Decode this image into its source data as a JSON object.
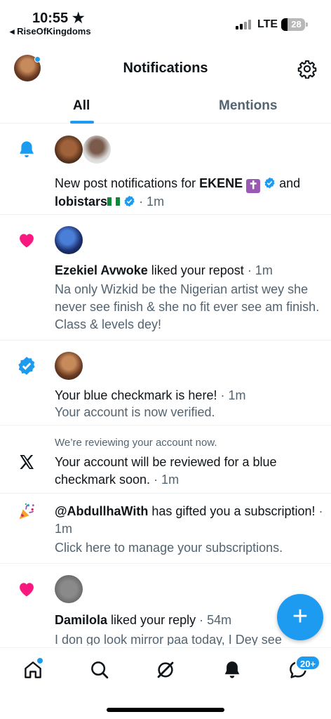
{
  "status_bar": {
    "time": "10:55 ★",
    "back_app": "◂ RiseOfKingdoms",
    "network": "LTE",
    "battery": "28"
  },
  "header": {
    "title": "Notifications"
  },
  "tabs": [
    {
      "label": "All",
      "active": true
    },
    {
      "label": "Mentions",
      "active": false
    }
  ],
  "notifications": [
    {
      "icon": "bell-icon",
      "prefix": "New post notifications for ",
      "name1": "EKENE",
      "conj": " and",
      "name2": "lobistars",
      "time": "· 1m"
    },
    {
      "icon": "heart-icon",
      "actor": "Ezekiel Avwoke",
      "action": " liked your repost",
      "time": " · 1m",
      "body": "Na only Wizkid be the Nigerian artist wey she never see finish & she no fit ever see am finish. Class & levels dey!"
    },
    {
      "icon": "verified-badge-icon",
      "title": "Your blue checkmark is here!",
      "time": " · 1m",
      "body": "Your account is now verified."
    },
    {
      "icon": "x-logo-icon",
      "header": "We’re reviewing your account now.",
      "title": "Your account will be reviewed for a blue checkmark soon.",
      "time": " · 1m"
    },
    {
      "icon": "party-popper-icon",
      "actor": "@AbdullhaWith",
      "action": " has gifted you a subscription!",
      "time": " · 1m",
      "body": "Click here to manage your subscriptions."
    },
    {
      "icon": "heart-icon",
      "actor": "Damilola",
      "action": " liked your reply",
      "time": " · 54m",
      "body": "I don go look mirror paa today, I Dey see"
    }
  ],
  "fab": {
    "label": "+"
  },
  "bottom_nav": {
    "items": [
      "home-icon",
      "search-icon",
      "grok-icon",
      "notifications-icon",
      "messages-icon"
    ],
    "messages_badge": "20+"
  },
  "colors": {
    "accent": "#1d9bf0",
    "like": "#f91880",
    "text": "#0f1419",
    "muted": "#536471"
  }
}
